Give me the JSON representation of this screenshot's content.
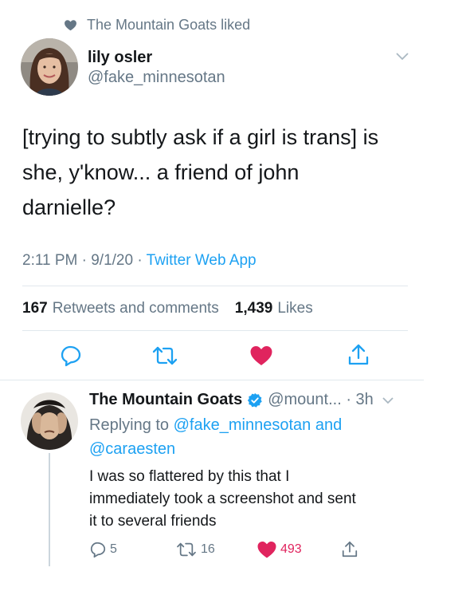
{
  "social_context": {
    "text": "The Mountain Goats liked",
    "icon": "heart-icon"
  },
  "tweet": {
    "display_name": "lily osler",
    "handle": "@fake_minnesotan",
    "text_lines": [
      "[trying to subtly ask if a girl is trans] is",
      "she, y'know... a friend of john",
      "darnielle?"
    ],
    "time": "2:11 PM · 9/1/20 · ",
    "source": "Twitter Web App",
    "retweets_count": "167",
    "retweets_label": "Retweets and comments",
    "likes_count": "1,439",
    "likes_label": "Likes"
  },
  "reply": {
    "display_name": "The Mountain Goats",
    "handle_time": "@mount... · 3h",
    "replying_prefix": "Replying to ",
    "replying_user1": "@fake_minnesotan",
    "replying_and": " and",
    "replying_user2": "@caraesten",
    "text_lines": [
      "I was so flattered by this that I",
      "immediately took a screenshot and sent",
      "it to several friends"
    ],
    "reply_count": "5",
    "retweet_count": "16",
    "like_count": "493"
  },
  "colors": {
    "accent": "#1da1f2",
    "like": "#e0245e",
    "muted": "#657786",
    "text": "#14171a",
    "divider": "#e1e8ed"
  }
}
